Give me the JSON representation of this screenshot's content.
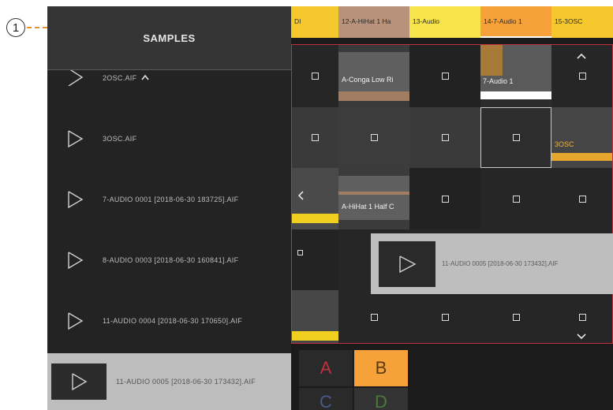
{
  "callout": {
    "number": "1"
  },
  "samples_panel": {
    "title": "SAMPLES",
    "items": [
      {
        "label": "2OSC.AIF"
      },
      {
        "label": "3OSC.AIF"
      },
      {
        "label": "7-AUDIO 0001 [2018-06-30 183725].AIF"
      },
      {
        "label": "8-AUDIO 0003 [2018-06-30 160841].AIF"
      },
      {
        "label": "11-AUDIO 0004 [2018-06-30 170650].AIF"
      },
      {
        "label": "11-AUDIO 0005 [2018-06-30 173432].AIF"
      }
    ]
  },
  "tracks": [
    {
      "label": "DI",
      "color": "#f5c92e"
    },
    {
      "label": "12-A-HiHat 1 Ha",
      "color": "#b8927a"
    },
    {
      "label": "13-Audio",
      "color": "#f7e34a"
    },
    {
      "label": "14-7-Audio 1",
      "color": "#f6a13a"
    },
    {
      "label": "15-3OSC",
      "color": "#f5c92e"
    }
  ],
  "clips": {
    "conga": "A-Conga Low Ri",
    "audio7": "7-Audio 1",
    "osc3": "3OSC",
    "hihat": "A-HiHat 1 Half C"
  },
  "drag_popup": {
    "label": "11-AUDIO 0005 [2018-06-30 173432].AIF"
  },
  "scenes": [
    "A",
    "B",
    "C",
    "D"
  ],
  "colors": {
    "accent_red": "#c0303f",
    "scene_b": "#f6a13a",
    "scene_d_text": "#4a7a3a",
    "scene_c_text": "#4a5a8a"
  },
  "icons": [
    "play-icon",
    "chevron-up-icon",
    "chevron-down-icon",
    "chevron-left-icon"
  ]
}
